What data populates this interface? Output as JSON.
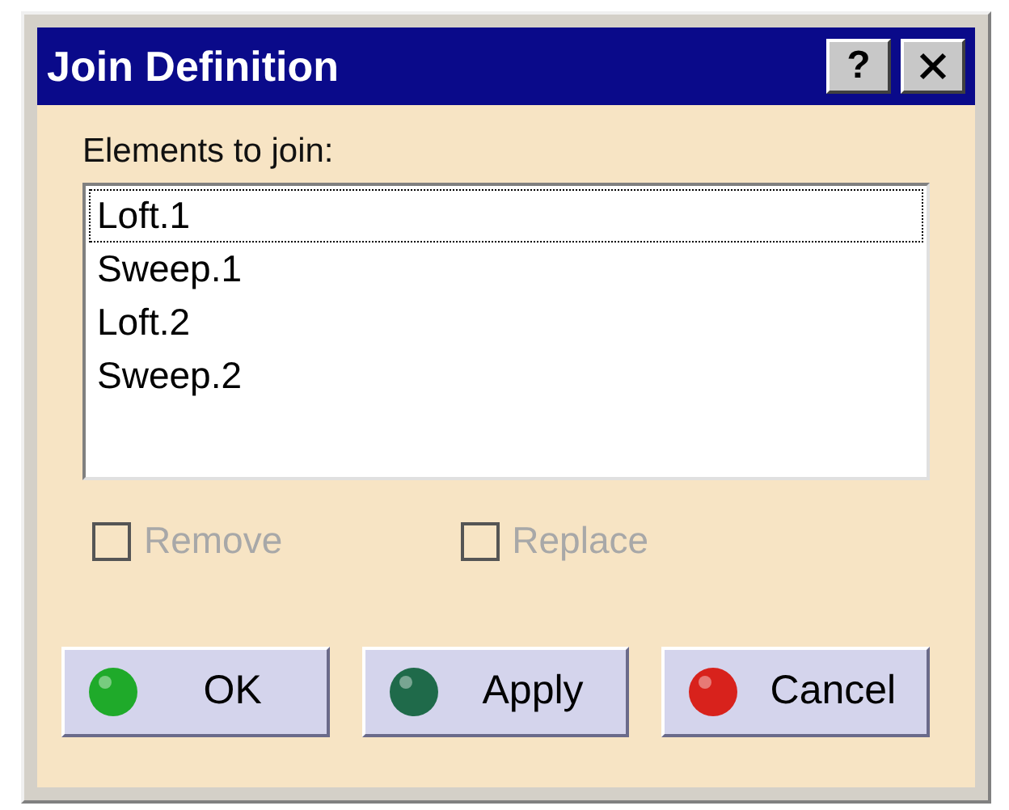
{
  "window": {
    "title": "Join Definition",
    "help": "?"
  },
  "list": {
    "label": "Elements to join:",
    "items": [
      {
        "text": "Loft.1",
        "focused": true
      },
      {
        "text": "Sweep.1",
        "focused": false
      },
      {
        "text": "Loft.2",
        "focused": false
      },
      {
        "text": "Sweep.2",
        "focused": false
      }
    ]
  },
  "options": [
    {
      "label": "Remove",
      "checked": false,
      "disabled": true
    },
    {
      "label": "Replace",
      "checked": false,
      "disabled": true
    }
  ],
  "buttons": [
    {
      "label": "OK",
      "color": "#1faa2a"
    },
    {
      "label": "Apply",
      "color": "#1f6a4a"
    },
    {
      "label": "Cancel",
      "color": "#d8221c"
    }
  ]
}
